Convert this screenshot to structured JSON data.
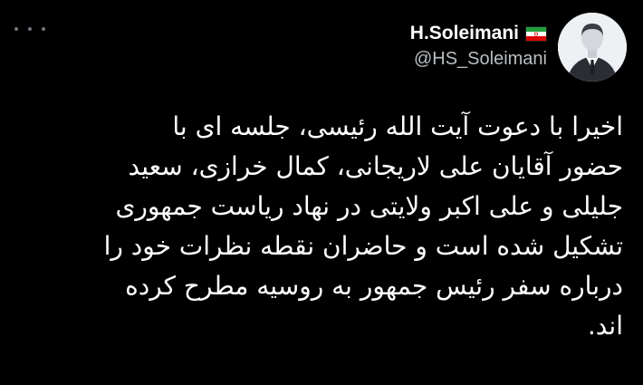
{
  "tweet": {
    "author": {
      "display_name": "H.Soleimani",
      "handle": "@HS_Soleimani",
      "flag_icon": "iran-flag-icon"
    },
    "menu_icon": "more-options-icon",
    "text_lines": [
      "اخیرا با دعوت آیت الله رئیسی، جلسه ای با",
      "حضور آقایان علی لاریجانی، کمال خرازی، سعید",
      "جلیلی و علی اکبر ولایتی در نهاد ریاست جمهوری",
      "تشکیل شده است و حاضران نقطه نظرات خود را",
      "درباره سفر رئیس جمهور به روسیه مطرح کرده",
      "اند."
    ]
  },
  "colors": {
    "background": "#000000",
    "text": "#ffffff",
    "secondary_text": "#b9bec2",
    "flag_green": "#239f40",
    "flag_white": "#ffffff",
    "flag_red": "#da0000"
  }
}
